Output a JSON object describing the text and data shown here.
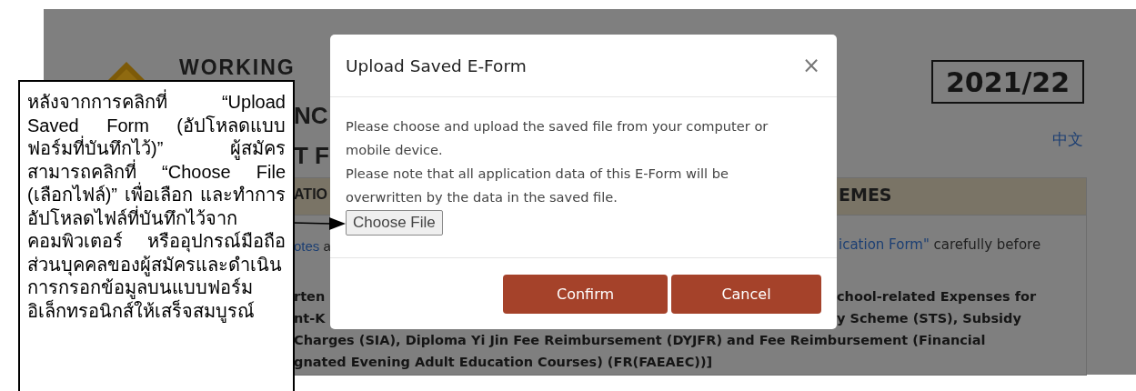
{
  "background_page": {
    "title_fragments": [
      "WORKING",
      "NC",
      "T F"
    ],
    "year": "2021/22",
    "language_link": "中文",
    "section_bar": {
      "left": "ATIO",
      "right": "EMES"
    },
    "notes_left": {
      "link": "otes",
      "rest": "a"
    },
    "notes_right": {
      "link": "ication Form\"",
      "rest": "carefully before"
    },
    "left_fragments": [
      "rten",
      "nt-K"
    ],
    "right_fragments": [
      "chool-related Expenses for",
      "y Scheme (STS), Subsidy"
    ],
    "full_lines": [
      "Charges (SIA), Diploma Yi Jin Fee Reimbursement (DYJFR) and Fee Reimbursement (Financial",
      "gnated Evening Adult Education Courses) (FR(FAEAEC))]"
    ]
  },
  "modal": {
    "title": "Upload Saved E-Form",
    "close": "×",
    "paragraphs": [
      "Please choose and upload the saved file from your computer or mobile device.",
      "Please note that all application data of this E-Form will be overwritten by the data in the saved file."
    ],
    "file_button": "Choose File",
    "buttons": [
      {
        "label": "Confirm"
      },
      {
        "label": "Cancel"
      }
    ]
  },
  "callout": {
    "text": "หลังจากการคลิกที่ “Upload Saved Form (อัปโหลดแบบฟอร์มที่บันทึกไว้)” ผู้สมัครสามารถคลิกที่ “Choose File (เลือกไฟล์)” เพื่อเลือก และทำการอัปโหลดไฟล์ที่บันทึกไว้จากคอมพิวเตอร์ หรืออุปกรณ์มือถือส่วนบุคคลของผู้สมัครและดำเนินการกรอกข้อมูลบนแบบฟอร์มอิเล็กทรอนิกส์ให้เสร็จสมบูรณ์"
  }
}
